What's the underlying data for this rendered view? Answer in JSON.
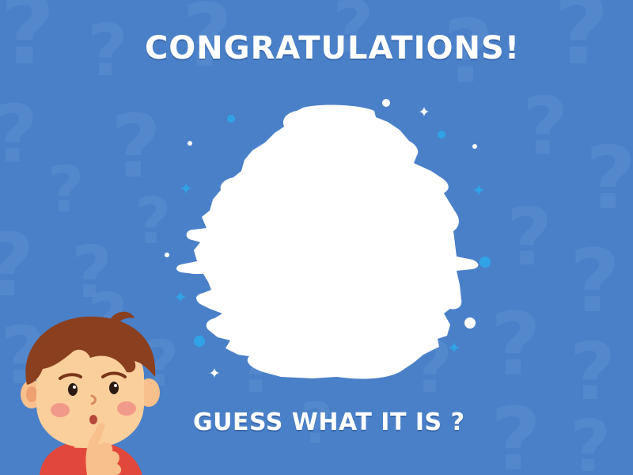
{
  "title": "CONGRATULATIONS!",
  "prompt": "GUESS WHAT IT IS ?",
  "background_glyph": "?",
  "colors": {
    "background": "#4a80c8",
    "pattern": "#5b8fd2",
    "panel": "#ffffff",
    "sparkle_blue": "#2fa3e6",
    "sparkle_white": "#ffffff"
  },
  "icons": {
    "mascot": "thinking-boy-icon",
    "sparkles": "sparkle-icon"
  }
}
